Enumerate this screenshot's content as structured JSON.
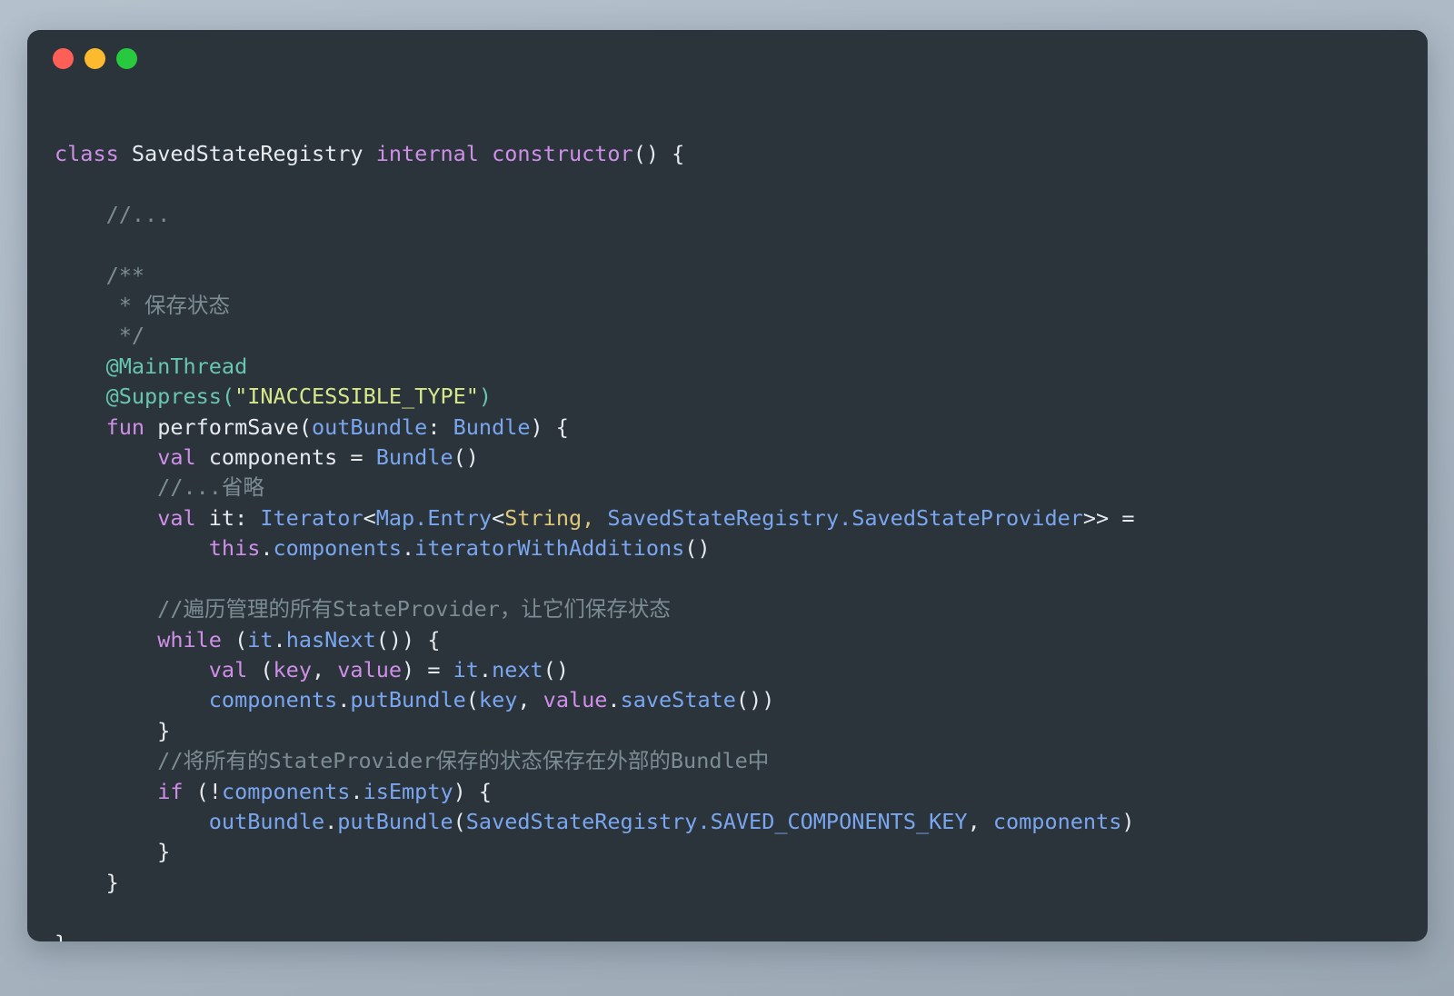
{
  "window": {
    "title": "",
    "controls": [
      {
        "name": "close",
        "color": "#ff5f56"
      },
      {
        "name": "minimize",
        "color": "#fcbb2e"
      },
      {
        "name": "maximize",
        "color": "#28c83f"
      }
    ]
  },
  "theme": {
    "page_background": "#aebbc7",
    "card_background": "#2b343b",
    "text": "#d6dde3",
    "keyword": "#cf8ee8",
    "type": "#7aa6f0",
    "string": "#d7e88a",
    "annotation": "#69c6ae",
    "comment": "#7d8c93",
    "generic_arg": "#e0c878"
  },
  "code": {
    "language": "kotlin",
    "lines": [
      {
        "n": 1,
        "tokens": [
          {
            "t": "class",
            "c": "kw"
          },
          {
            "t": " ",
            "c": "pln"
          },
          {
            "t": "SavedStateRegistry",
            "c": "pln"
          },
          {
            "t": " ",
            "c": "pln"
          },
          {
            "t": "internal",
            "c": "kw"
          },
          {
            "t": " ",
            "c": "pln"
          },
          {
            "t": "constructor",
            "c": "kw"
          },
          {
            "t": "() {",
            "c": "pun"
          }
        ]
      },
      {
        "n": 2,
        "tokens": []
      },
      {
        "n": 3,
        "tokens": [
          {
            "t": "    //...",
            "c": "cmt"
          }
        ]
      },
      {
        "n": 4,
        "tokens": []
      },
      {
        "n": 5,
        "tokens": [
          {
            "t": "    /**",
            "c": "cmt"
          }
        ]
      },
      {
        "n": 6,
        "tokens": [
          {
            "t": "     * 保存状态",
            "c": "cmt"
          }
        ]
      },
      {
        "n": 7,
        "tokens": [
          {
            "t": "     */",
            "c": "cmt"
          }
        ]
      },
      {
        "n": 8,
        "tokens": [
          {
            "t": "    @MainThread",
            "c": "ann"
          }
        ]
      },
      {
        "n": 9,
        "tokens": [
          {
            "t": "    @Suppress",
            "c": "ann"
          },
          {
            "t": "(",
            "c": "ann"
          },
          {
            "t": "\"INACCESSIBLE_TYPE\"",
            "c": "str"
          },
          {
            "t": ")",
            "c": "ann"
          }
        ]
      },
      {
        "n": 10,
        "tokens": [
          {
            "t": "    ",
            "c": "pln"
          },
          {
            "t": "fun",
            "c": "kw"
          },
          {
            "t": " performSave",
            "c": "pln"
          },
          {
            "t": "(",
            "c": "pun"
          },
          {
            "t": "outBundle",
            "c": "typ"
          },
          {
            "t": ": ",
            "c": "pun"
          },
          {
            "t": "Bundle",
            "c": "typ"
          },
          {
            "t": ") {",
            "c": "pun"
          }
        ]
      },
      {
        "n": 11,
        "tokens": [
          {
            "t": "        ",
            "c": "pln"
          },
          {
            "t": "val",
            "c": "kw"
          },
          {
            "t": " components = ",
            "c": "pln"
          },
          {
            "t": "Bundle",
            "c": "typ"
          },
          {
            "t": "()",
            "c": "pun"
          }
        ]
      },
      {
        "n": 12,
        "tokens": [
          {
            "t": "        //...省略",
            "c": "cmt"
          }
        ]
      },
      {
        "n": 13,
        "tokens": [
          {
            "t": "        ",
            "c": "pln"
          },
          {
            "t": "val",
            "c": "kw"
          },
          {
            "t": " it",
            "c": "pln"
          },
          {
            "t": ": ",
            "c": "pun"
          },
          {
            "t": "Iterator",
            "c": "typ"
          },
          {
            "t": "<",
            "c": "pun"
          },
          {
            "t": "Map.Entry",
            "c": "typ"
          },
          {
            "t": "<",
            "c": "pun"
          },
          {
            "t": "String",
            "c": "gold"
          },
          {
            "t": ", ",
            "c": "gold"
          },
          {
            "t": "SavedStateRegistry.SavedStateProvider",
            "c": "typ"
          },
          {
            "t": ">> =",
            "c": "pun"
          }
        ]
      },
      {
        "n": 14,
        "tokens": [
          {
            "t": "            ",
            "c": "pln"
          },
          {
            "t": "this",
            "c": "kw"
          },
          {
            "t": ".",
            "c": "pun"
          },
          {
            "t": "components",
            "c": "typ"
          },
          {
            "t": ".",
            "c": "pun"
          },
          {
            "t": "iteratorWithAdditions",
            "c": "typ"
          },
          {
            "t": "()",
            "c": "pun"
          }
        ]
      },
      {
        "n": 15,
        "tokens": []
      },
      {
        "n": 16,
        "tokens": [
          {
            "t": "        //遍历管理的所有StateProvider，让它们保存状态",
            "c": "cmt"
          }
        ]
      },
      {
        "n": 17,
        "tokens": [
          {
            "t": "        ",
            "c": "pln"
          },
          {
            "t": "while",
            "c": "kw"
          },
          {
            "t": " (",
            "c": "pun"
          },
          {
            "t": "it",
            "c": "typ"
          },
          {
            "t": ".",
            "c": "pun"
          },
          {
            "t": "hasNext",
            "c": "typ"
          },
          {
            "t": "()) {",
            "c": "pun"
          }
        ]
      },
      {
        "n": 18,
        "tokens": [
          {
            "t": "            ",
            "c": "pln"
          },
          {
            "t": "val",
            "c": "kw"
          },
          {
            "t": " (",
            "c": "pun"
          },
          {
            "t": "key",
            "c": "kw"
          },
          {
            "t": ", ",
            "c": "pun"
          },
          {
            "t": "value",
            "c": "kw"
          },
          {
            "t": ") = ",
            "c": "pun"
          },
          {
            "t": "it",
            "c": "typ"
          },
          {
            "t": ".",
            "c": "pun"
          },
          {
            "t": "next",
            "c": "typ"
          },
          {
            "t": "()",
            "c": "pun"
          }
        ]
      },
      {
        "n": 19,
        "tokens": [
          {
            "t": "            ",
            "c": "pln"
          },
          {
            "t": "components",
            "c": "typ"
          },
          {
            "t": ".",
            "c": "pun"
          },
          {
            "t": "putBundle",
            "c": "typ"
          },
          {
            "t": "(",
            "c": "pun"
          },
          {
            "t": "key",
            "c": "typ"
          },
          {
            "t": ", ",
            "c": "pun"
          },
          {
            "t": "value",
            "c": "kw"
          },
          {
            "t": ".",
            "c": "pun"
          },
          {
            "t": "saveState",
            "c": "typ"
          },
          {
            "t": "())",
            "c": "pun"
          }
        ]
      },
      {
        "n": 20,
        "tokens": [
          {
            "t": "        }",
            "c": "pun"
          }
        ]
      },
      {
        "n": 21,
        "tokens": [
          {
            "t": "        //将所有的StateProvider保存的状态保存在外部的Bundle中",
            "c": "cmt"
          }
        ]
      },
      {
        "n": 22,
        "tokens": [
          {
            "t": "        ",
            "c": "pln"
          },
          {
            "t": "if",
            "c": "kw"
          },
          {
            "t": " (!",
            "c": "pun"
          },
          {
            "t": "components",
            "c": "typ"
          },
          {
            "t": ".",
            "c": "pun"
          },
          {
            "t": "isEmpty",
            "c": "typ"
          },
          {
            "t": ") {",
            "c": "pun"
          }
        ]
      },
      {
        "n": 23,
        "tokens": [
          {
            "t": "            ",
            "c": "pln"
          },
          {
            "t": "outBundle",
            "c": "typ"
          },
          {
            "t": ".",
            "c": "pun"
          },
          {
            "t": "putBundle",
            "c": "typ"
          },
          {
            "t": "(",
            "c": "pun"
          },
          {
            "t": "SavedStateRegistry.SAVED_COMPONENTS_KEY",
            "c": "typ"
          },
          {
            "t": ", ",
            "c": "pun"
          },
          {
            "t": "components",
            "c": "typ"
          },
          {
            "t": ")",
            "c": "pun"
          }
        ]
      },
      {
        "n": 24,
        "tokens": [
          {
            "t": "        }",
            "c": "pun"
          }
        ]
      },
      {
        "n": 25,
        "tokens": [
          {
            "t": "    }",
            "c": "pun"
          }
        ]
      },
      {
        "n": 26,
        "tokens": []
      },
      {
        "n": 27,
        "tokens": [
          {
            "t": "}",
            "c": "pun"
          }
        ]
      }
    ]
  }
}
